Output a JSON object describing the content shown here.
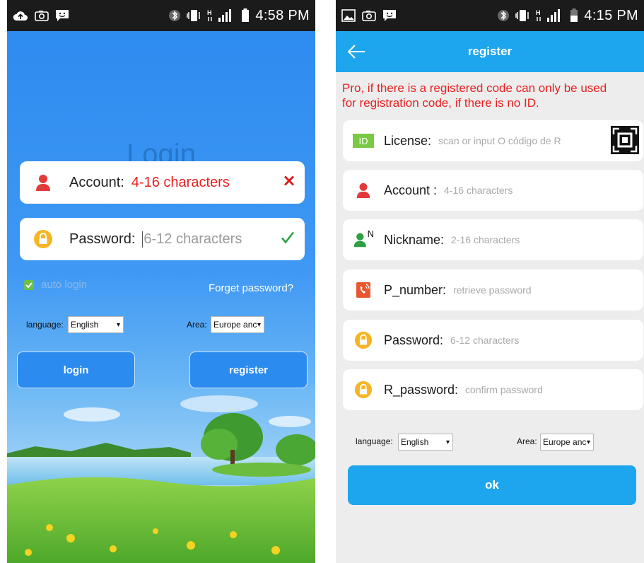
{
  "left": {
    "status": {
      "time": "4:58 PM"
    },
    "title": "Login",
    "account": {
      "label": "Account:",
      "value": "4-16 characters",
      "status_icon": "close-icon"
    },
    "password": {
      "label": "Password:",
      "placeholder": "6-12 characters",
      "status_icon": "check-icon"
    },
    "auto_login": {
      "label": "auto login",
      "checked": true
    },
    "forget_password": "Forget password?",
    "language": {
      "label": "language:",
      "value": "English"
    },
    "area": {
      "label": "Area:",
      "value": "Europe anc"
    },
    "login_button": "login",
    "register_button": "register"
  },
  "right": {
    "status": {
      "time": "4:15 PM"
    },
    "appbar": {
      "title": "register"
    },
    "notice_line1": "Pro, if there is a registered code can only be used",
    "notice_line2": "for registration code, if there is no ID.",
    "fields": [
      {
        "icon": "id-icon",
        "badge": "ID",
        "label": "License:",
        "placeholder": "scan or input O código de R"
      },
      {
        "icon": "person-icon",
        "label": "Account :",
        "placeholder": "4-16 characters"
      },
      {
        "icon": "nickname-icon",
        "badge": "N",
        "label": "Nickname:",
        "placeholder": "2-16 characters"
      },
      {
        "icon": "phone-icon",
        "label": "P_number:",
        "placeholder": "retrieve password"
      },
      {
        "icon": "lock-icon",
        "label": "Password:",
        "placeholder": "6-12 characters"
      },
      {
        "icon": "lock-icon",
        "label": "R_password:",
        "placeholder": "confirm password"
      }
    ],
    "language": {
      "label": "language:",
      "value": "English"
    },
    "area": {
      "label": "Area:",
      "value": "Europe anc"
    },
    "ok_button": "ok"
  },
  "colors": {
    "login_blue": "#2e8bf0",
    "appbar_blue": "#1da6ee",
    "error_red": "#e8201f",
    "success_green": "#2ea043"
  }
}
